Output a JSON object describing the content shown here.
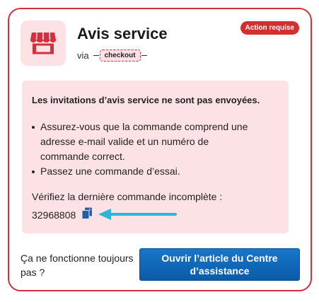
{
  "header": {
    "title": "Avis service",
    "via_text": "via",
    "tag": "checkout",
    "badge": "Action requise"
  },
  "alert": {
    "title": "Les invitations d’avis service ne sont pas envoyées.",
    "bullets": [
      "Assurez-vous que la commande comprend une adresse e-mail valide et un numéro de commande correct.",
      "Passez une commande d’essai."
    ],
    "check_label": "Vérifiez la dernière commande incomplète :",
    "order_number": "32968808"
  },
  "footer": {
    "question": "Ça ne fonctionne toujours pas ?",
    "button_label": "Ouvrir l’article du Centre d’assistance"
  },
  "icons": {
    "store": "store-icon",
    "copy": "copy-icon",
    "arrow": "arrow-pointer"
  },
  "colors": {
    "accent_red": "#d32f3f",
    "alert_bg": "#fde2e5",
    "button_blue": "#0a5ba8",
    "arrow_cyan": "#29b6d8"
  }
}
